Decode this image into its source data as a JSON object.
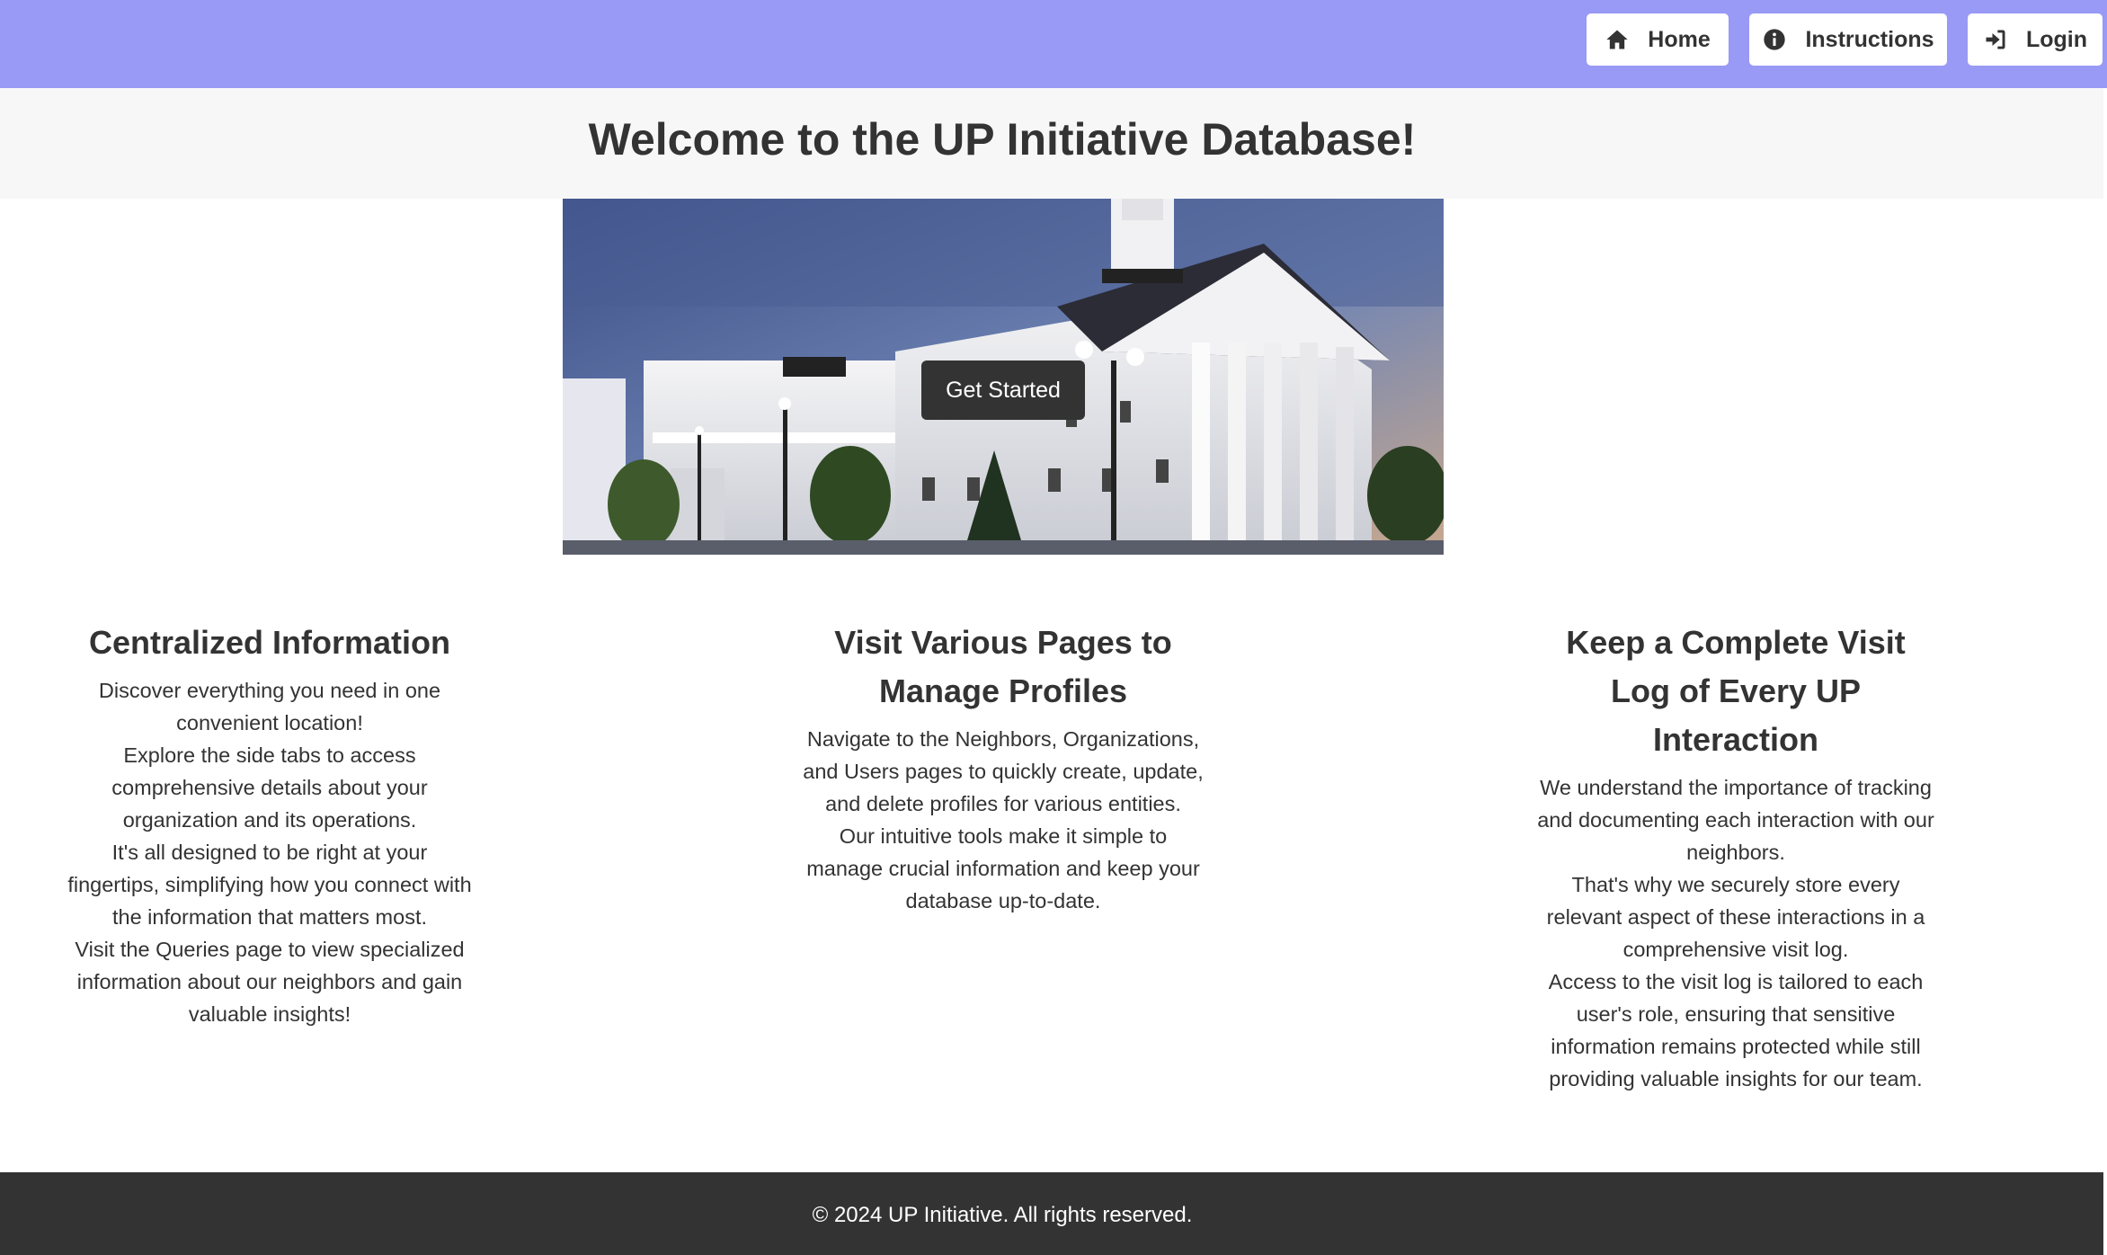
{
  "nav": {
    "home_label": "Home",
    "home_icon": "home-icon",
    "instructions_label": "Instructions",
    "instructions_icon": "info-circle-icon",
    "login_label": "Login",
    "login_icon": "sign-in-icon"
  },
  "header": {
    "title": "Welcome to the UP Initiative Database!"
  },
  "hero": {
    "button_label": "Get Started"
  },
  "features": [
    {
      "title": "Centralized Information",
      "paragraphs": [
        "Discover everything you need in one convenient location!",
        "Explore the side tabs to access comprehensive details about your organization and its operations.",
        "It's all designed to be right at your fingertips, simplifying how you connect with the information that matters most.",
        "Visit the Queries page to view specialized information about our neighbors and gain valuable insights!"
      ]
    },
    {
      "title": "Visit Various Pages to Manage Profiles",
      "paragraphs": [
        "Navigate to the Neighbors, Organizations, and Users pages to quickly create, update, and delete profiles for various entities.",
        "Our intuitive tools make it simple to manage crucial information and keep your database up-to-date."
      ]
    },
    {
      "title": "Keep a Complete Visit Log of Every UP Interaction",
      "paragraphs": [
        "We understand the importance of tracking and documenting each interaction with our neighbors.",
        "That's why we securely store every relevant aspect of these interactions in a comprehensive visit log.",
        "Access to the visit log is tailored to each user's role, ensuring that sensitive information remains protected while still providing valuable insights for our team."
      ]
    }
  ],
  "footer": {
    "text": "© 2024 UP Initiative. All rights reserved."
  },
  "colors": {
    "topbar": "#9999f6",
    "header_band": "#f7f7f7",
    "text": "#333333",
    "footer": "#333333",
    "button_dark": "#333333"
  }
}
